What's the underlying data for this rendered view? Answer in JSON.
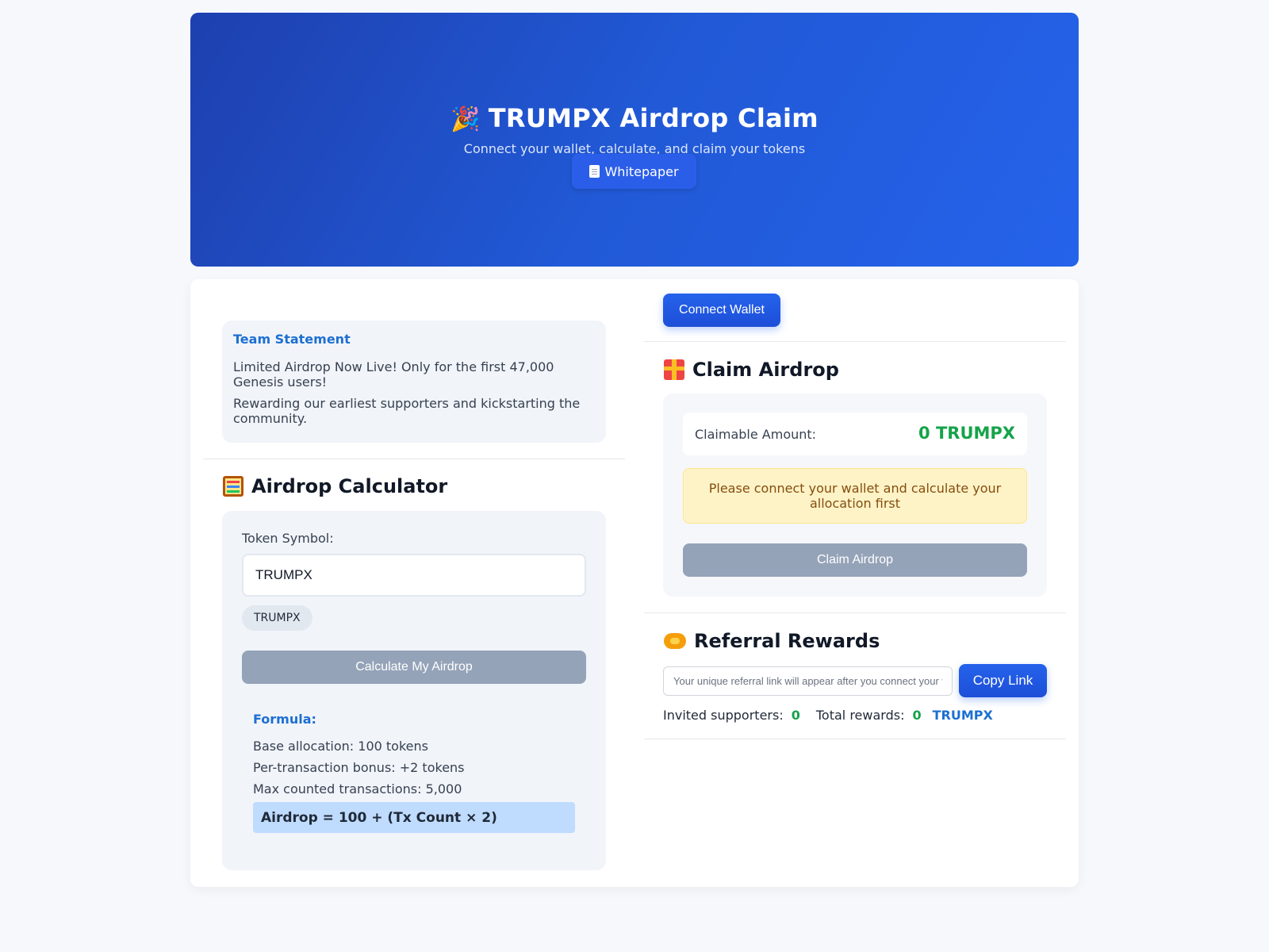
{
  "header": {
    "emoji": "🎉",
    "title": "TRUMPX Airdrop Claim",
    "subtitle": "Connect your wallet, calculate, and claim your tokens",
    "whitepaper_label": "Whitepaper"
  },
  "team_statement": {
    "title": "Team Statement",
    "line1": "Limited Airdrop Now Live! Only for the first 47,000 Genesis users!",
    "line2": "Rewarding our earliest supporters and kickstarting the community."
  },
  "calculator": {
    "title": "Airdrop Calculator",
    "token_label": "Token Symbol:",
    "token_value": "TRUMPX",
    "chip": "TRUMPX",
    "button_label": "Calculate My Airdrop",
    "formula": {
      "title": "Formula:",
      "base": "Base allocation: 100 tokens",
      "bonus": "Per-transaction bonus: +2 tokens",
      "max": "Max counted transactions: 5,000",
      "expression": "Airdrop = 100 + (Tx Count × 2)"
    }
  },
  "wallet": {
    "connect_label": "Connect Wallet"
  },
  "claim": {
    "title": "Claim Airdrop",
    "amount_label": "Claimable Amount:",
    "amount_value": "0 TRUMPX",
    "warning": "Please connect your wallet and calculate your allocation first",
    "button_label": "Claim Airdrop"
  },
  "referral": {
    "title": "Referral Rewards",
    "placeholder": "Your unique referral link will appear after you connect your wallet",
    "copy_label": "Copy Link",
    "invited_label": "Invited supporters:",
    "invited_value": "0",
    "rewards_label": "Total rewards:",
    "rewards_value": "0",
    "rewards_symbol": "TRUMPX"
  },
  "colors": {
    "accent": "#2563eb",
    "success": "#16a34a",
    "link": "#1d6fd1",
    "disabled": "#94a3b8",
    "warning_bg": "#fef3c7"
  }
}
